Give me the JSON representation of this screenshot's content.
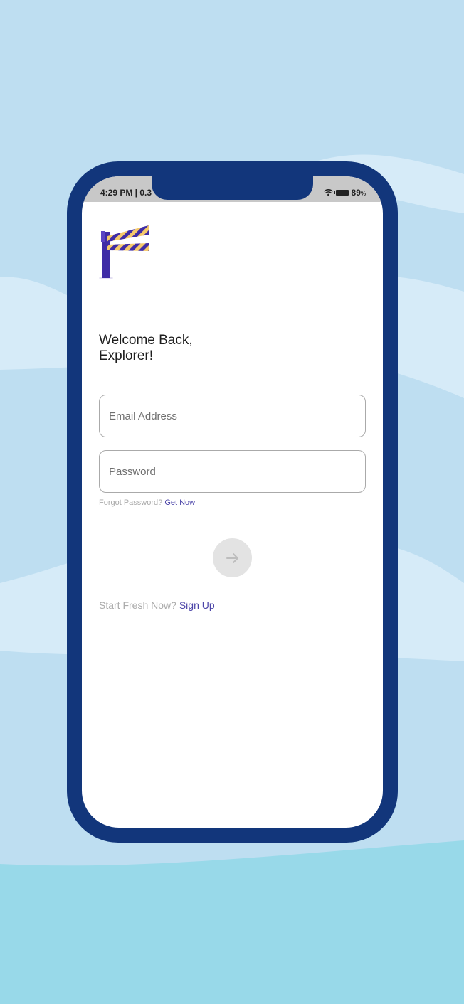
{
  "status_bar": {
    "time_text": "4:29 PM | 0.3",
    "battery_text": "89",
    "battery_unit": "%"
  },
  "login": {
    "greeting_line1": "Welcome Back,",
    "greeting_line2": "Explorer!",
    "email_placeholder": "Email Address",
    "password_placeholder": "Password",
    "forgot_text": "Forgot Password?",
    "forgot_link": "Get Now",
    "signup_text": "Start Fresh Now?",
    "signup_link": "Sign Up"
  },
  "icons": {
    "logo": "barrier-gate-icon",
    "submit": "arrow-right-icon",
    "wifi": "wifi-icon",
    "battery": "battery-icon"
  },
  "colors": {
    "background": "#bedef1",
    "background_light": "#d6ebf8",
    "background_bottom": "#98d9e9",
    "phone_frame": "#12367b",
    "link": "#4b44a8",
    "barrier_purple": "#3f2ca6",
    "barrier_stripe": "#f5c96b",
    "submit_button": "#e3e3e3"
  }
}
